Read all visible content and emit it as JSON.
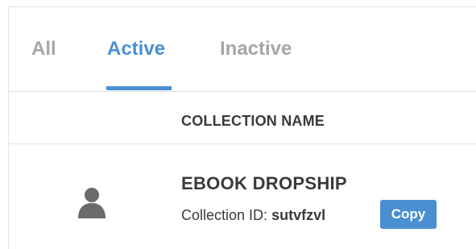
{
  "tabs": [
    {
      "label": "All"
    },
    {
      "label": "Active"
    },
    {
      "label": "Inactive"
    }
  ],
  "active_tab": "Active",
  "accent_color": "#4a8fd1",
  "table": {
    "column_header": "COLLECTION NAME"
  },
  "rows": [
    {
      "icon": "user-icon",
      "name": "EBOOK DROPSHIP",
      "id_label": "Collection ID:",
      "id_value": "sutvfzvl",
      "copy_label": "Copy"
    }
  ]
}
